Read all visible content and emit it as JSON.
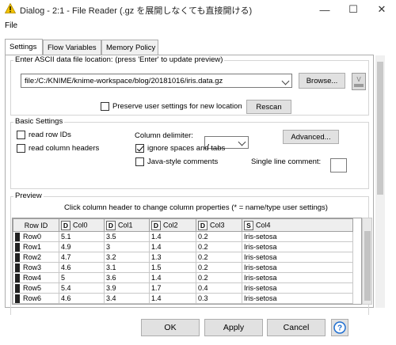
{
  "window": {
    "title": "Dialog - 2:1 - File Reader (.gz を展開しなくても直接開ける)",
    "minimize": "—",
    "maximize": "☐",
    "close": "✕"
  },
  "menu": {
    "file": "File"
  },
  "tabs": [
    {
      "label": "Settings",
      "active": true
    },
    {
      "label": "Flow Variables",
      "active": false
    },
    {
      "label": "Memory Policy",
      "active": false
    }
  ],
  "location": {
    "legend": "Enter ASCII data file location: (press 'Enter' to update preview)",
    "value": "file:/C:/KNIME/knime-workspace/blog/20181016/iris.data.gz",
    "browse": "Browse...",
    "preserve_label": "Preserve user settings for new location",
    "preserve_checked": false,
    "rescan": "Rescan"
  },
  "basic": {
    "legend": "Basic Settings",
    "read_row_ids": "read row IDs",
    "read_row_ids_checked": false,
    "read_column_headers": "read column headers",
    "read_column_headers_checked": false,
    "column_delimiter_label": "Column delimiter:",
    "column_delimiter_value": ",",
    "advanced": "Advanced...",
    "ignore_spaces": "ignore spaces and tabs",
    "ignore_spaces_checked": true,
    "java_comments": "Java-style comments",
    "java_comments_checked": false,
    "single_line_comment_label": "Single line comment:",
    "single_line_comment_value": ""
  },
  "preview": {
    "legend": "Preview",
    "hint": "Click column header to change column properties (* = name/type user settings)",
    "columns": [
      {
        "name": "Row ID",
        "type": ""
      },
      {
        "name": "Col0",
        "type": "D"
      },
      {
        "name": "Col1",
        "type": "D"
      },
      {
        "name": "Col2",
        "type": "D"
      },
      {
        "name": "Col3",
        "type": "D"
      },
      {
        "name": "Col4",
        "type": "S"
      }
    ],
    "rows": [
      [
        "Row0",
        "5.1",
        "3.5",
        "1.4",
        "0.2",
        "Iris-setosa"
      ],
      [
        "Row1",
        "4.9",
        "3",
        "1.4",
        "0.2",
        "Iris-setosa"
      ],
      [
        "Row2",
        "4.7",
        "3.2",
        "1.3",
        "0.2",
        "Iris-setosa"
      ],
      [
        "Row3",
        "4.6",
        "3.1",
        "1.5",
        "0.2",
        "Iris-setosa"
      ],
      [
        "Row4",
        "5",
        "3.6",
        "1.4",
        "0.2",
        "Iris-setosa"
      ],
      [
        "Row5",
        "5.4",
        "3.9",
        "1.7",
        "0.4",
        "Iris-setosa"
      ],
      [
        "Row6",
        "4.6",
        "3.4",
        "1.4",
        "0.3",
        "Iris-setosa"
      ]
    ]
  },
  "footer": {
    "ok": "OK",
    "apply": "Apply",
    "cancel": "Cancel",
    "help": "?"
  },
  "colors": {
    "warning": "#f2c200",
    "help_blue": "#1f6fd1",
    "row_marker": "#222222"
  }
}
